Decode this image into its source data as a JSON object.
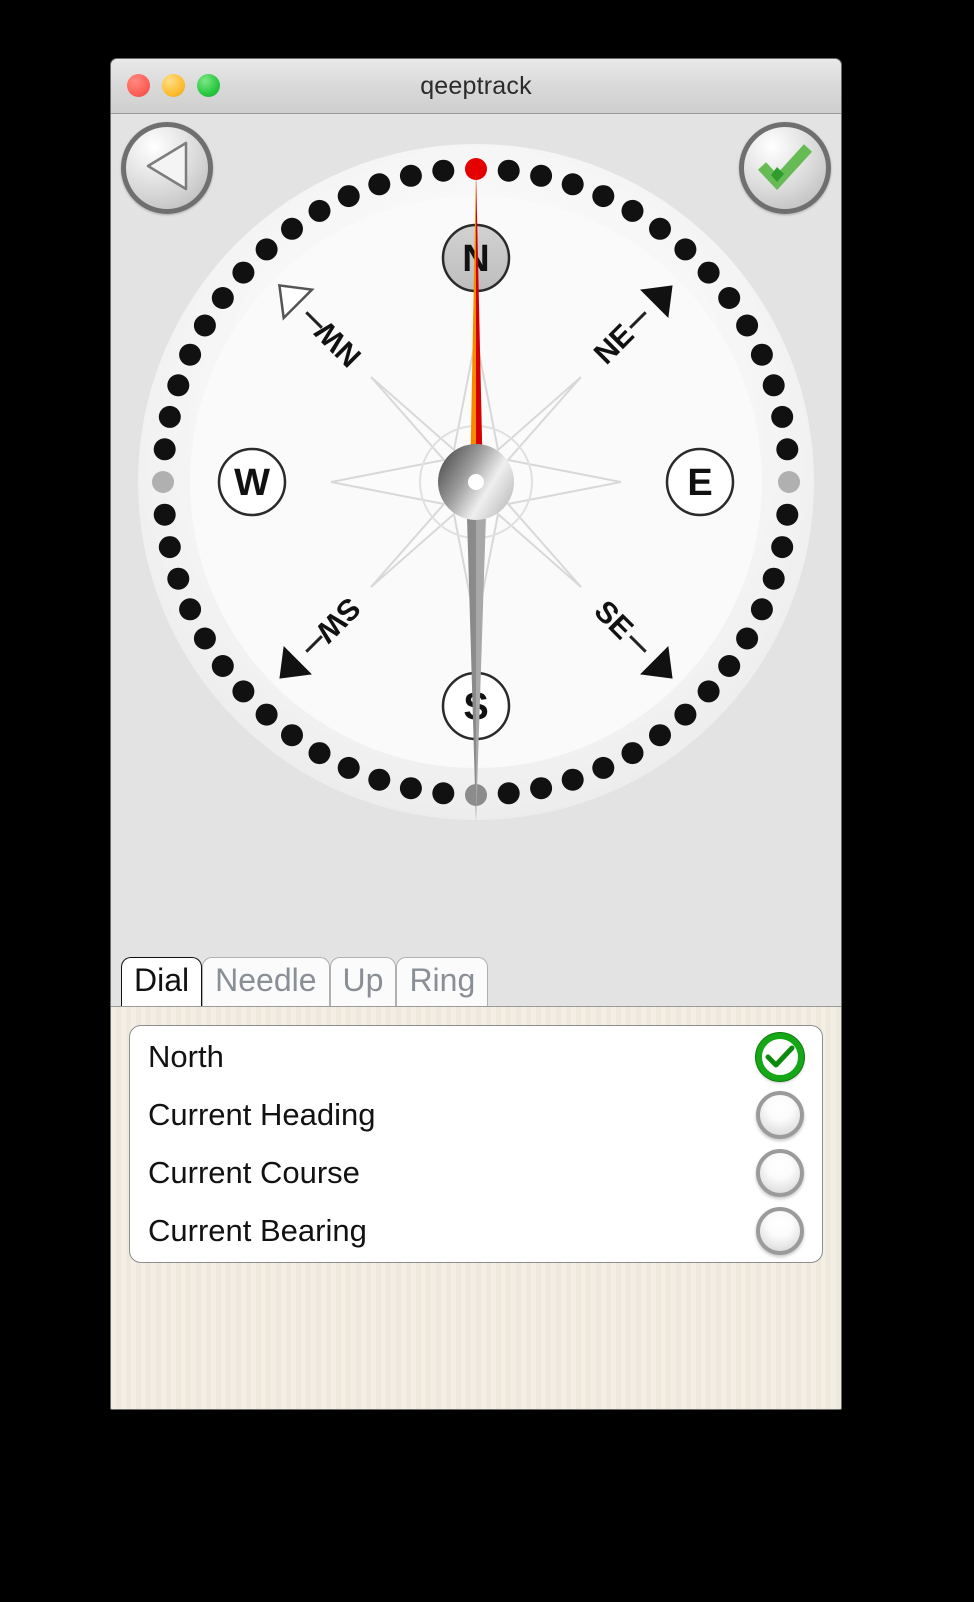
{
  "window": {
    "title": "qeeptrack",
    "traffic_lights": [
      "close-button",
      "minimize-button",
      "zoom-button"
    ]
  },
  "toolbar": {
    "back_icon": "back-triangle-icon",
    "confirm_icon": "green-check-icon"
  },
  "compass": {
    "cardinals": [
      {
        "label": "N",
        "angle": 0,
        "style": "filled-gray"
      },
      {
        "label": "E",
        "angle": 90,
        "style": "white"
      },
      {
        "label": "S",
        "angle": 180,
        "style": "white"
      },
      {
        "label": "W",
        "angle": 270,
        "style": "white"
      }
    ],
    "intercardinals": [
      {
        "label": "NE",
        "angle": 45,
        "arrow": "filled"
      },
      {
        "label": "SE",
        "angle": 135,
        "arrow": "filled"
      },
      {
        "label": "SW",
        "angle": 225,
        "arrow": "filled"
      },
      {
        "label": "NW",
        "angle": 315,
        "arrow": "outline"
      }
    ],
    "tick_count": 60,
    "tick_color": "#111111",
    "marker_north_color": "#e50000",
    "marker_south_color": "#8c8c8c",
    "marker_west_color": "#b0b0b0",
    "marker_east_color": "#b0b0b0",
    "needle_heading_deg": 0,
    "needle_north_left_color": "#f58a00",
    "needle_north_right_color": "#d40000",
    "needle_south_color": "#8f8f8f",
    "hub_center_color": "#ffffff",
    "rose_stroke": "#d8d8d8"
  },
  "tabs": [
    {
      "label": "Dial",
      "active": true
    },
    {
      "label": "Needle",
      "active": false
    },
    {
      "label": "Up",
      "active": false
    },
    {
      "label": "Ring",
      "active": false
    }
  ],
  "options": {
    "items": [
      {
        "label": "North",
        "selected": true
      },
      {
        "label": "Current Heading",
        "selected": false
      },
      {
        "label": "Current Course",
        "selected": false
      },
      {
        "label": "Current Bearing",
        "selected": false
      }
    ]
  },
  "colors": {
    "window_bg": "#e3e3e3",
    "panel_bg": "#f2ede3",
    "accent_green": "#16a716",
    "needle_red": "#d40000",
    "needle_orange": "#f58a00"
  }
}
